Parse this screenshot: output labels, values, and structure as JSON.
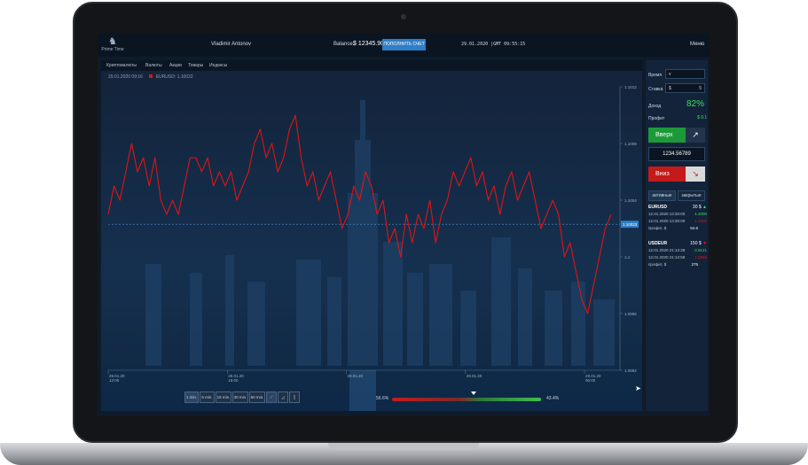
{
  "app": {
    "logo_text": "Prime Time",
    "logo_sub": "finance"
  },
  "topbar": {
    "user": "Vladimir Antonov",
    "balance_label": "Balance:",
    "balance_value": "$ 12345.90",
    "deposit_label": "ПОПОЛНИТЬ СЧЕТ",
    "datetime": "29.01.2020 |GMT 09:55:15",
    "menu_label": "Меню"
  },
  "tabs": [
    "Криптовалюты",
    "Валюты",
    "Акции",
    "Товары",
    "Индексы"
  ],
  "legend": {
    "date": "29.01.2020 09:16",
    "pair": "EURUSD: 1.10022"
  },
  "timeframes": [
    "1 min.",
    "5 min.",
    "15 min.",
    "30 min.",
    "60 min."
  ],
  "sentiment": {
    "down": "56.6%",
    "up": "43.4%",
    "down_color": "#c81a1a",
    "up_color": "#3fbf4f"
  },
  "side": {
    "time_label": "Время",
    "time_value": "v",
    "stake_label": "Ставка",
    "stake_currency": "$",
    "stake_value": "5",
    "income_label": "Доход",
    "income_value": "82%",
    "profit_label": "Профит",
    "profit_value": "$ 9.1",
    "up_label": "Вверх",
    "price": "1234.56789",
    "down_label": "Вниз",
    "tab_active": "активные",
    "tab_closed": "закрытые"
  },
  "trades": [
    {
      "symbol": "EURUSD",
      "amount": "30 $",
      "dir": "▲",
      "open": "12.01.2020 13:30:00",
      "open_price": "1.2000",
      "close": "12.01.2020 13:30:00",
      "close_price": "1.1900",
      "profit_label": "профит, $",
      "profit": "54.6"
    },
    {
      "symbol": "USDEUR",
      "amount": "150 $",
      "dir": "▼",
      "open": "12.01.2020 21:12:28",
      "open_price": "0.9121",
      "close": "12.01.2020 21:12:58",
      "close_price": "1.0886",
      "profit_label": "профит, $",
      "profit": "275"
    }
  ],
  "colors": {
    "accent": "#2f7fc7",
    "up": "#1c9a3a",
    "down": "#c41a1a",
    "line": "#e01414"
  },
  "chart_data": {
    "type": "line",
    "title": "",
    "xlabel": "",
    "ylabel": "",
    "x_ticks": [
      "29.01.20 12:00",
      "29.01.20 18:00",
      "29.01.20",
      "29.01.20",
      "29.01.20 06:00"
    ],
    "y_ticks": [
      "1.1012",
      "1.1008",
      "1.1004",
      "1.1",
      "1.0996",
      "1.0992"
    ],
    "ylim": [
      1.0992,
      1.1012
    ],
    "current_price": "1.10023",
    "grid": false,
    "series": [
      {
        "values": [
          1.1003,
          1.1005,
          1.1004,
          1.1006,
          1.1008,
          1.1006,
          1.1007,
          1.1005,
          1.1007,
          1.1004,
          1.1003,
          1.1004,
          1.1003,
          1.1005,
          1.1007,
          1.1007,
          1.1006,
          1.1007,
          1.1005,
          1.1006,
          1.1005,
          1.1006,
          1.1004,
          1.1005,
          1.1006,
          1.1008,
          1.1009,
          1.1007,
          1.1008,
          1.1006,
          1.1007,
          1.1009,
          1.101,
          1.1007,
          1.1005,
          1.1006,
          1.1004,
          1.1005,
          1.1006,
          1.1004,
          1.1002,
          1.1003,
          1.1005,
          1.1004,
          1.1006,
          1.1005,
          1.1003,
          1.1004,
          1.1001,
          1.1002,
          1.1,
          1.1003,
          1.1001,
          1.1003,
          1.1002,
          1.1004,
          1.1001,
          1.1003,
          1.1004,
          1.1006,
          1.1005,
          1.1006,
          1.1007,
          1.1005,
          1.1006,
          1.1004,
          1.1005,
          1.1003,
          1.1005,
          1.1006,
          1.1004,
          1.1005,
          1.1006,
          1.1004,
          1.1002,
          1.1003,
          1.1004,
          1.1003,
          1.1,
          1.1001,
          1.0999,
          1.0997,
          1.0996,
          1.0998,
          1.1,
          1.1002,
          1.1003
        ]
      }
    ]
  }
}
